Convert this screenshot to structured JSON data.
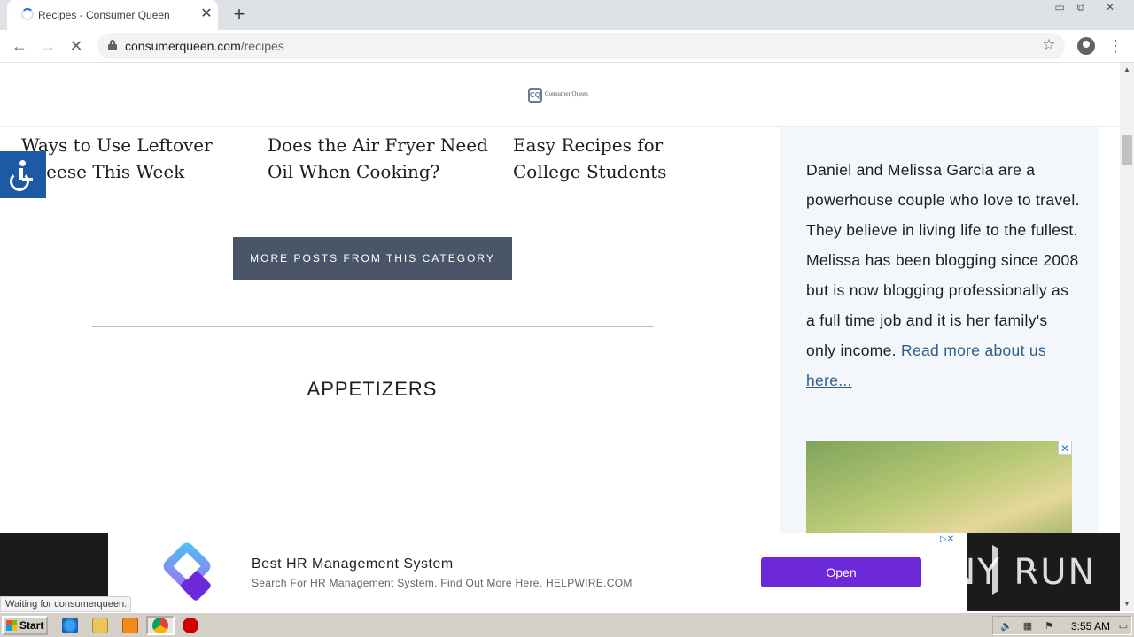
{
  "browser": {
    "tab_title": "Recipes - Consumer Queen",
    "tab_close": "✕",
    "new_tab": "+",
    "url_domain": "consumerqueen.com",
    "url_path": "/recipes",
    "window_minimize": "▭",
    "window_restore": "⧉",
    "window_close": "✕"
  },
  "site": {
    "logo_text": "Consumer Queen",
    "posts": [
      {
        "title": "Ways to Use Leftover Cheese This Week"
      },
      {
        "title": "Does the Air Fryer Need Oil When Cooking?"
      },
      {
        "title": "Easy Recipes for College Students"
      }
    ],
    "more_posts_label": "MORE POSTS FROM THIS CATEGORY",
    "section_heading": "APPETIZERS"
  },
  "sidebar": {
    "about_text": "Daniel and Melissa Garcia are a powerhouse couple who love to travel. They believe in living life to the fullest. Melissa has been blogging since 2008 but is now blogging professionally as a full time job and it is her family's only income.",
    "about_link": "Read more about us here..."
  },
  "ad": {
    "title": "Best HR Management System",
    "description": "Search For HR Management System. Find Out More Here. HELPWIRE.COM",
    "button_label": "Open",
    "choices": "▷✕",
    "watermark": "ANY  RUN"
  },
  "status": {
    "text": "Waiting for consumerqueen..."
  },
  "taskbar": {
    "start_label": "Start",
    "clock": "3:55 AM"
  },
  "colors": {
    "button_bg": "#4a5567",
    "sidebar_bg": "#f3f6fa",
    "link": "#2f5d8a",
    "ad_button": "#6d28d9",
    "accessibility": "#1c5aa6"
  }
}
